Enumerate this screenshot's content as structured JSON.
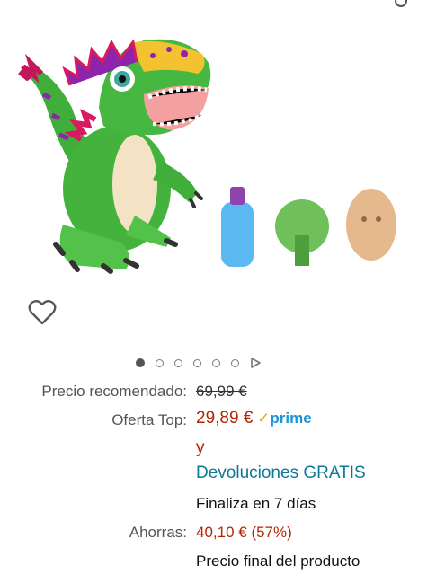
{
  "product": {
    "image_alt": "Dinosaur toy with accessories",
    "image_count": 6
  },
  "pricing": {
    "list_price_label": "Precio recomendado:",
    "list_price": "69,99 €",
    "deal_label": "Oferta Top:",
    "deal_price": "29,89 €",
    "prime_check": "✓",
    "prime_text": "prime",
    "and_text": "y",
    "returns_text": "Devoluciones GRATIS",
    "ends_text": "Finaliza en 7 días",
    "savings_label": "Ahorras:",
    "savings_value": "40,10 € (57%)",
    "final_price_text": "Precio final del producto"
  },
  "colors": {
    "price": "#b12704",
    "prime": "#1e94d6",
    "link": "#0e7897"
  }
}
